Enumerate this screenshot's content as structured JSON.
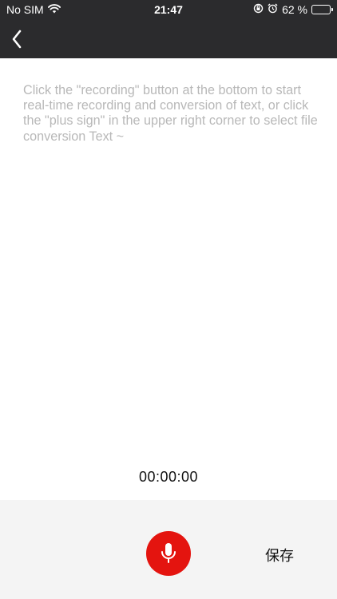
{
  "status_bar": {
    "carrier": "No SIM",
    "time": "21:47",
    "battery_percent": "62 %",
    "battery_level": 0.62,
    "icons": [
      "wifi-icon",
      "rotation-lock-icon",
      "alarm-icon",
      "battery-icon"
    ]
  },
  "nav": {
    "back_icon": "chevron-left-icon"
  },
  "content": {
    "hint": "Click the \"recording\" button at the bottom to start real-time recording and conversion of text, or click the \"plus sign\" in the upper right corner to select file conversion Text ~",
    "timer": "00:00:00"
  },
  "bottom": {
    "mic_icon": "microphone-icon",
    "mic_color": "#e4140f",
    "save_label": "保存"
  }
}
